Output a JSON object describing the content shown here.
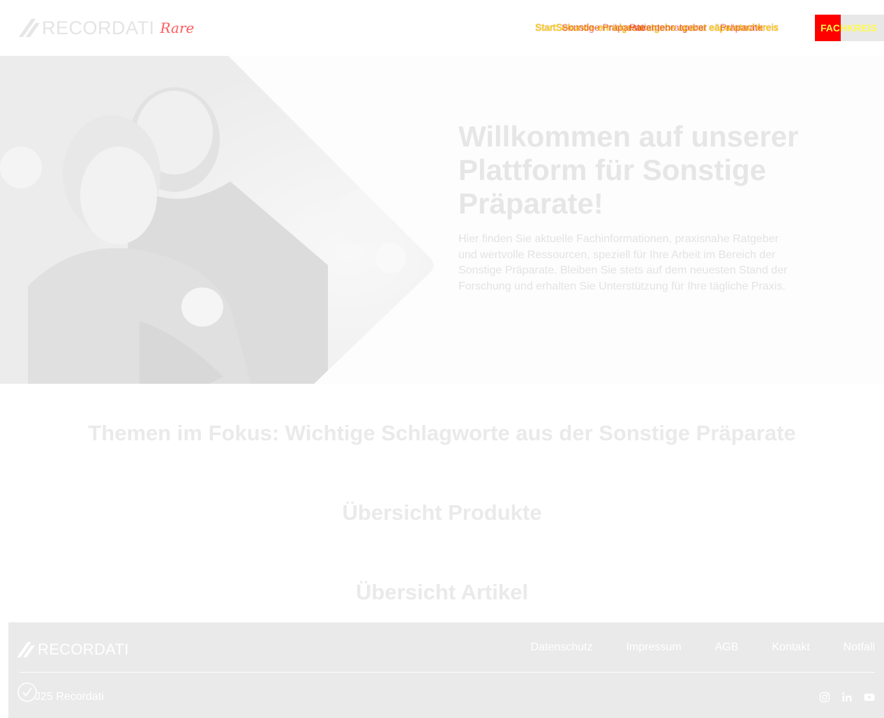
{
  "header": {
    "logo_text": "RECORDATI",
    "logo_sub": "Rare",
    "nav": [
      "Start",
      "Sonstige Präparate",
      "Patientenratgeber",
      "Fachinformationen",
      "Präparate",
      "Praxis",
      "Fachkreis"
    ],
    "nav_overlap_text": "StartSekunde-ennalgesaratgebe aparat eäparatachkreis",
    "cta_label": "FACHKREIS",
    "brand_red": "#ff0000",
    "highlight_yellow": "#f6e800"
  },
  "hero": {
    "title": "Willkommen auf unserer Plattform für Sonstige Präparate!",
    "text": "Hier finden Sie aktuelle Fachinformationen, praxisnahe Ratgeber und wertvolle Ressourcen, speziell für Ihre Arbeit im Bereich der Sonstige Präparate. Bleiben Sie stets auf dem neuesten Stand der Forschung und erhalten Sie Unterstützung für Ihre tägliche Praxis."
  },
  "sections": {
    "topics": "Themen im Fokus: Wichtige Schlagworte aus der Sonstige Präparate",
    "products": "Übersicht Produkte",
    "articles": "Übersicht Artikel"
  },
  "footer": {
    "logo_text": "RECORDATI",
    "links": [
      "Datenschutz",
      "Impressum",
      "AGB",
      "Kontakt",
      "Notfall"
    ],
    "copyright": "J25 Recordati",
    "social_icons": [
      "instagram-icon",
      "linkedin-icon",
      "youtube-icon"
    ]
  }
}
